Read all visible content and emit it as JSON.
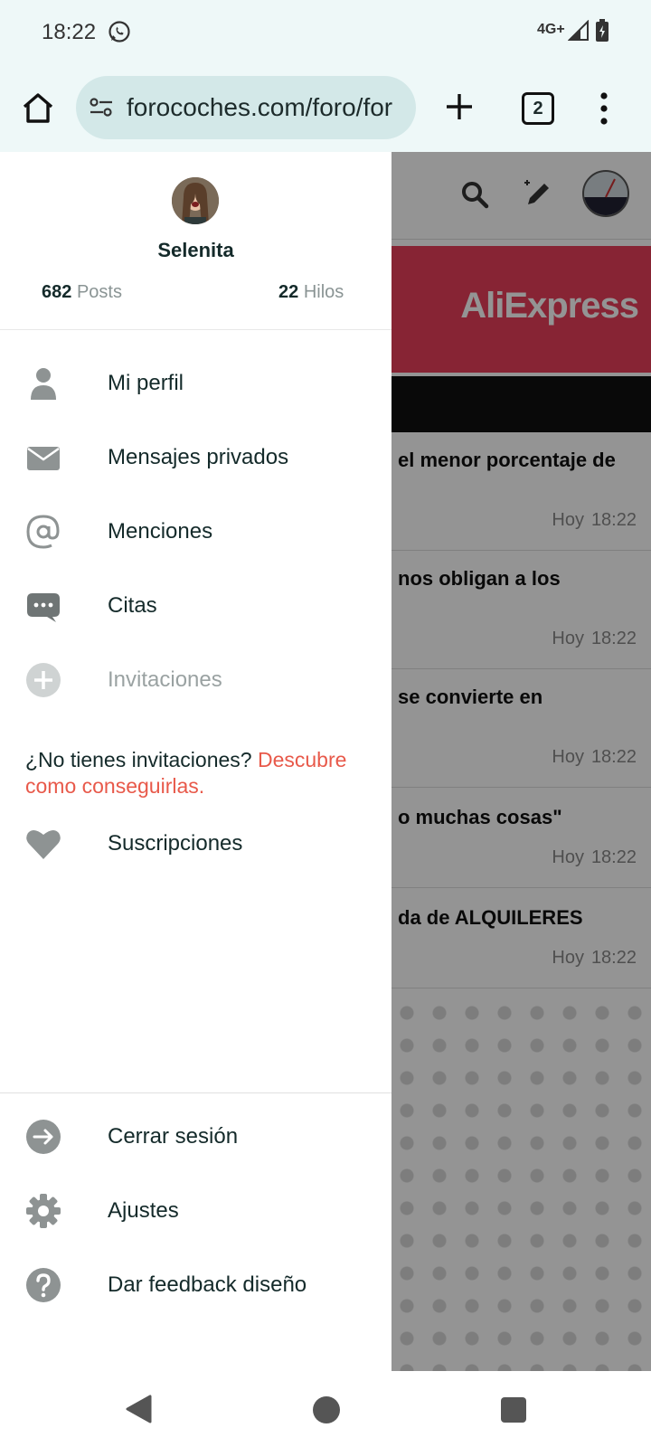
{
  "status_bar": {
    "time": "18:22",
    "network": "4G+"
  },
  "browser": {
    "url": "forocoches.com/foro/for",
    "tab_count": "2"
  },
  "page": {
    "ad_text": "AliExpress",
    "threads": [
      {
        "title": "el menor porcentaje de",
        "date": "Hoy",
        "time": "18:22"
      },
      {
        "title": "nos obligan a los",
        "date": "Hoy",
        "time": "18:22"
      },
      {
        "title": "se convierte en",
        "date": "Hoy",
        "time": "18:22"
      },
      {
        "title": "o muchas cosas\"",
        "date": "Hoy",
        "time": "18:22"
      },
      {
        "title": "da de ALQUILERES",
        "date": "Hoy",
        "time": "18:22"
      }
    ]
  },
  "drawer": {
    "username": "Selenita",
    "posts_count": "682",
    "posts_label": "Posts",
    "threads_count": "22",
    "threads_label": "Hilos",
    "menu": {
      "profile": "Mi perfil",
      "messages": "Mensajes privados",
      "mentions": "Menciones",
      "quotes": "Citas",
      "invitations": "Invitaciones",
      "subscriptions": "Suscripciones",
      "logout": "Cerrar sesión",
      "settings": "Ajustes",
      "feedback": "Dar feedback diseño"
    },
    "invite_note": "¿No tienes invitaciones?",
    "invite_link": "Descubre como conseguirlas."
  },
  "icons": {
    "accent": "#e8594a",
    "icon_color": "#8e9393"
  }
}
